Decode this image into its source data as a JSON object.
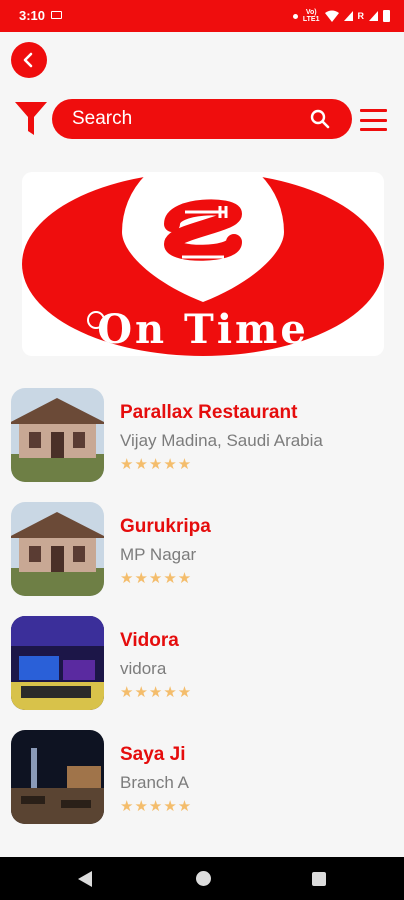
{
  "status_bar": {
    "time": "3:10",
    "volte_top": "Vo)",
    "volte_bottom": "LTE1",
    "roaming_mark": "R"
  },
  "search": {
    "placeholder": "Search"
  },
  "banner": {
    "logo_text": "On Time"
  },
  "restaurants": [
    {
      "name": "Parallax Restaurant",
      "address": "Vijay Madina, Saudi Arabia",
      "rating": 4.5,
      "stars": "★★★★★",
      "image": "house"
    },
    {
      "name": "Gurukripa",
      "address": "MP Nagar",
      "rating": 4.5,
      "stars": "★★★★★",
      "image": "house"
    },
    {
      "name": "Vidora",
      "address": "vidora",
      "rating": 4.5,
      "stars": "★★★★★",
      "image": "lounge"
    },
    {
      "name": "Saya Ji",
      "address": "Branch A",
      "rating": 4.5,
      "stars": "★★★★★",
      "image": "night-terrace"
    }
  ],
  "colors": {
    "primary": "#ef0d0d",
    "star": "#f4bd6c",
    "subtitle": "#7c7c7c"
  },
  "icons": {
    "back": "chevron-left-icon",
    "filter": "filter-icon",
    "search": "search-icon",
    "menu": "hamburger-menu-icon"
  }
}
